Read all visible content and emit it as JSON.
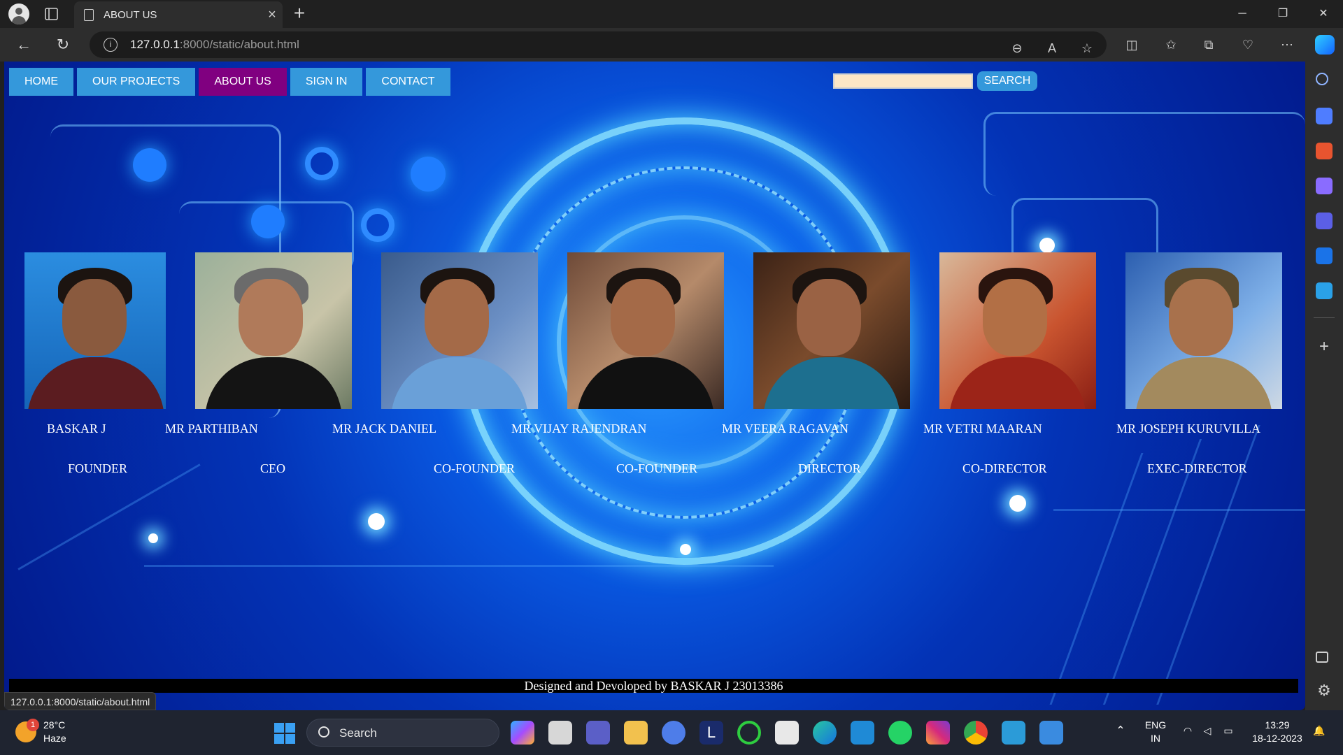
{
  "browser": {
    "tab_title": "ABOUT US",
    "url_host": "127.0.0.1",
    "url_rest": ":8000/static/about.html",
    "status_url": "127.0.0.1:8000/static/about.html"
  },
  "nav": {
    "items": [
      {
        "label": "HOME",
        "active": false
      },
      {
        "label": "OUR PROJECTS",
        "active": false
      },
      {
        "label": "ABOUT US",
        "active": true
      },
      {
        "label": "SIGN IN",
        "active": false
      },
      {
        "label": "CONTACT",
        "active": false
      }
    ],
    "search_button": "SEARCH",
    "search_value": ""
  },
  "people": [
    {
      "name": "BASKAR J",
      "role": "FOUNDER"
    },
    {
      "name": "MR PARTHIBAN",
      "role": "CEO"
    },
    {
      "name": "MR JACK DANIEL",
      "role": "CO-FOUNDER"
    },
    {
      "name": "MR VIJAY RAJENDRAN",
      "role": "CO-FOUNDER"
    },
    {
      "name": "MR VEERA RAGAVAN",
      "role": "DIRECTOR"
    },
    {
      "name": "MR VETRI MAARAN",
      "role": "CO-DIRECTOR"
    },
    {
      "name": "MR JOSEPH KURUVILLA",
      "role": "EXEC-DIRECTOR"
    }
  ],
  "footer": "Designed and Devoloped by BASKAR J 23013386",
  "taskbar": {
    "temperature": "28°C",
    "weather": "Haze",
    "weather_badge": "1",
    "search_label": "Search",
    "lang": "ENG",
    "region": "IN",
    "time": "13:29",
    "date": "18-12-2023"
  },
  "colors": {
    "nav_button": "#3498db",
    "nav_active": "#800080",
    "page_bg": "#0a5ee8"
  }
}
